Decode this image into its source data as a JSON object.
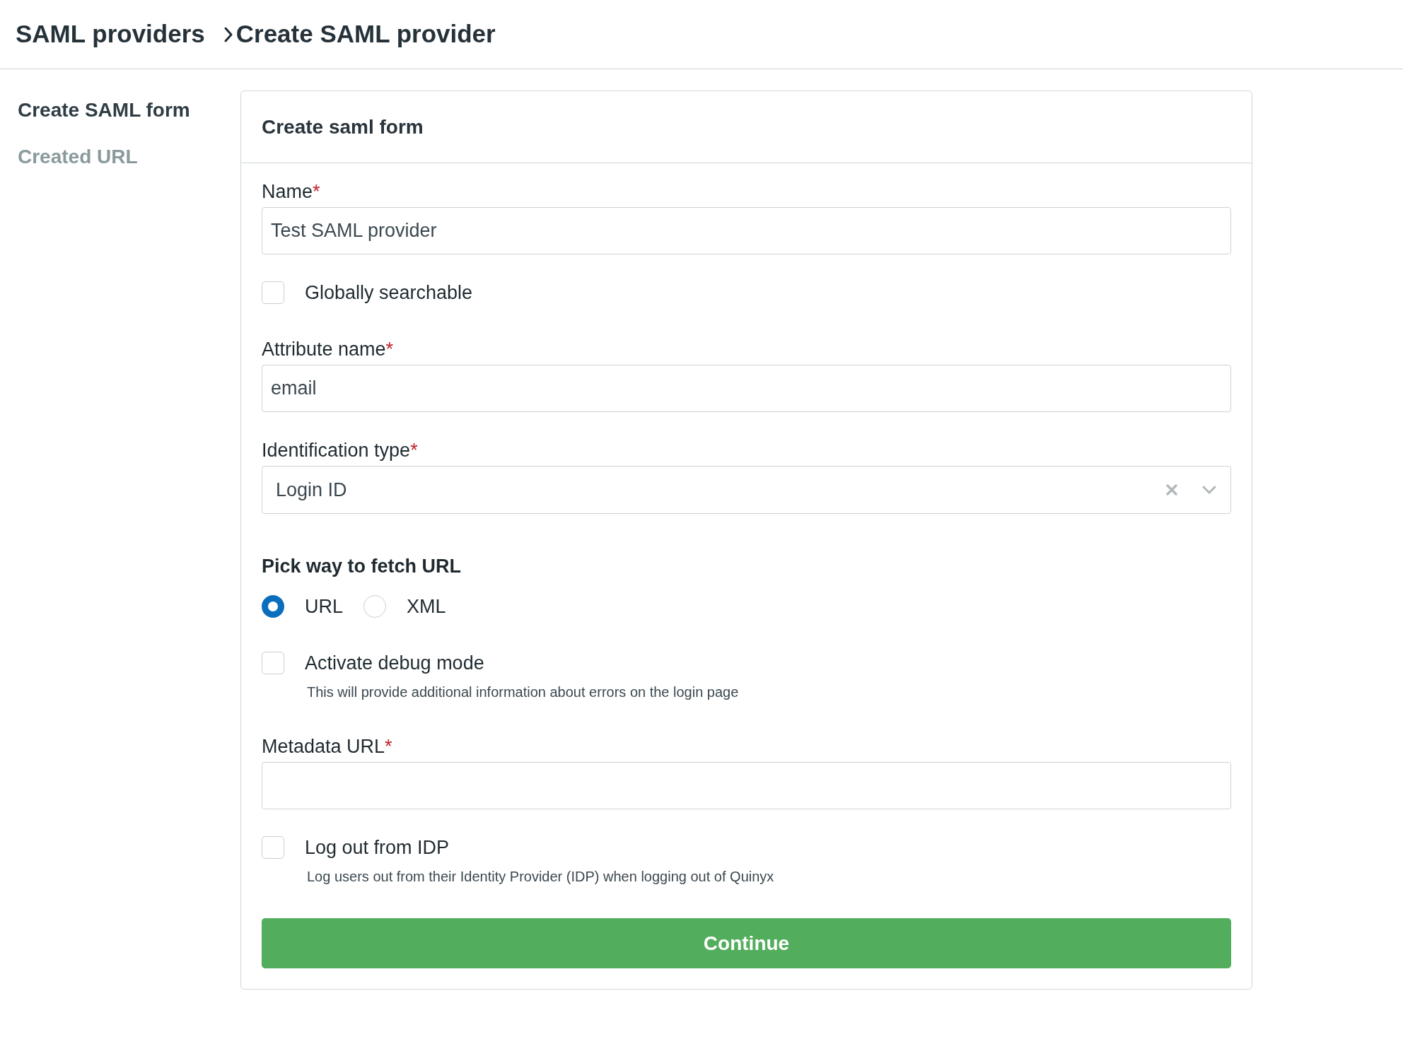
{
  "breadcrumb": [
    {
      "label": "SAML providers"
    },
    {
      "label": "Create SAML provider"
    }
  ],
  "sidebar": {
    "items": [
      {
        "label": "Create SAML form",
        "selected": true
      },
      {
        "label": "Created URL",
        "selected": false
      }
    ]
  },
  "card": {
    "title": "Create saml form",
    "fields": [
      {
        "kind": "text",
        "label": "Name",
        "required_mark": "*",
        "value": "Test SAML provider"
      },
      {
        "kind": "checkbox",
        "label": "Globally searchable",
        "checked": false
      },
      {
        "kind": "text",
        "label": "Attribute name",
        "required_mark": "*",
        "value": "email"
      },
      {
        "kind": "select",
        "label": "Identification type",
        "required_mark": "*",
        "value": "Login ID"
      },
      {
        "kind": "radio",
        "heading": "Pick way to fetch URL",
        "options": [
          {
            "label": "URL",
            "selected": true
          },
          {
            "label": "XML",
            "selected": false
          }
        ]
      },
      {
        "kind": "checkbox",
        "label": "Activate debug mode",
        "checked": false,
        "help": "This will provide additional information about errors on the login page"
      },
      {
        "kind": "text",
        "label": "Metadata URL",
        "required_mark": "*"
      },
      {
        "kind": "checkbox",
        "label": "Log out from IDP",
        "checked": false,
        "help": "Log users out from their Identity Provider (IDP) when logging out of Quinyx"
      }
    ],
    "button": "Continue"
  }
}
